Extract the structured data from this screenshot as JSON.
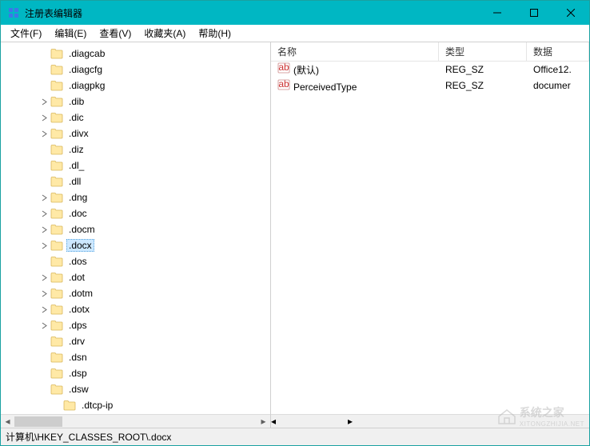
{
  "window": {
    "title": "注册表编辑器"
  },
  "menu": {
    "file": "文件(F)",
    "edit": "编辑(E)",
    "view": "查看(V)",
    "favorites": "收藏夹(A)",
    "help": "帮助(H)"
  },
  "tree": {
    "selected_index": 12,
    "nodes": [
      {
        "label": ".diagcab",
        "depth": 3,
        "expandable": false
      },
      {
        "label": ".diagcfg",
        "depth": 3,
        "expandable": false
      },
      {
        "label": ".diagpkg",
        "depth": 3,
        "expandable": false
      },
      {
        "label": ".dib",
        "depth": 3,
        "expandable": true
      },
      {
        "label": ".dic",
        "depth": 3,
        "expandable": true
      },
      {
        "label": ".divx",
        "depth": 3,
        "expandable": true
      },
      {
        "label": ".diz",
        "depth": 3,
        "expandable": false
      },
      {
        "label": ".dl_",
        "depth": 3,
        "expandable": false
      },
      {
        "label": ".dll",
        "depth": 3,
        "expandable": false
      },
      {
        "label": ".dng",
        "depth": 3,
        "expandable": true
      },
      {
        "label": ".doc",
        "depth": 3,
        "expandable": true
      },
      {
        "label": ".docm",
        "depth": 3,
        "expandable": true
      },
      {
        "label": ".docx",
        "depth": 3,
        "expandable": true
      },
      {
        "label": ".dos",
        "depth": 3,
        "expandable": false
      },
      {
        "label": ".dot",
        "depth": 3,
        "expandable": true
      },
      {
        "label": ".dotm",
        "depth": 3,
        "expandable": true
      },
      {
        "label": ".dotx",
        "depth": 3,
        "expandable": true
      },
      {
        "label": ".dps",
        "depth": 3,
        "expandable": true
      },
      {
        "label": ".drv",
        "depth": 3,
        "expandable": false
      },
      {
        "label": ".dsn",
        "depth": 3,
        "expandable": false
      },
      {
        "label": ".dsp",
        "depth": 3,
        "expandable": false
      },
      {
        "label": ".dsw",
        "depth": 3,
        "expandable": false
      },
      {
        "label": ".dtcp-ip",
        "depth": 4,
        "expandable": false
      }
    ]
  },
  "list": {
    "columns": {
      "name": "名称",
      "type": "类型",
      "data": "数据"
    },
    "rows": [
      {
        "name": "(默认)",
        "type": "REG_SZ",
        "data": "Office12."
      },
      {
        "name": "PerceivedType",
        "type": "REG_SZ",
        "data": "documer"
      }
    ]
  },
  "statusbar": {
    "path": "计算机\\HKEY_CLASSES_ROOT\\.docx"
  },
  "watermark": {
    "text": "系统之家",
    "sub": "XITONGZHIJIA.NET"
  }
}
